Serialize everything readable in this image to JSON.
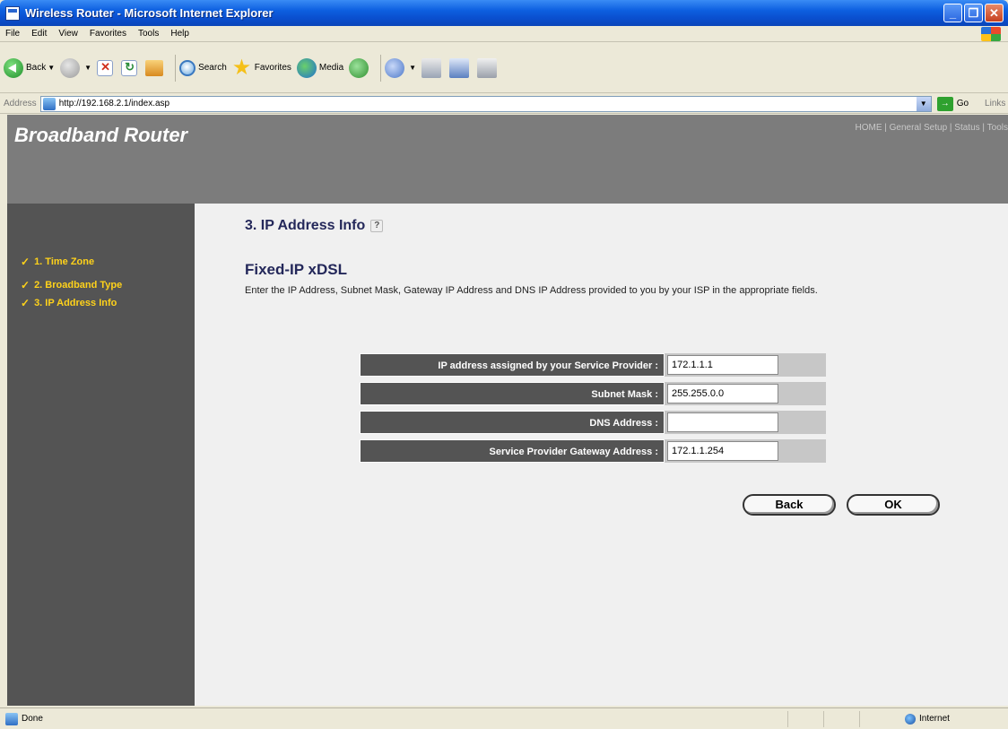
{
  "window": {
    "title": "Wireless Router - Microsoft Internet Explorer",
    "minimize": "_",
    "maximize": "❐",
    "close": "✕"
  },
  "menu": [
    "File",
    "Edit",
    "View",
    "Favorites",
    "Tools",
    "Help"
  ],
  "toolbar": {
    "back_label": "Back",
    "search_label": "Search",
    "favorites_label": "Favorites",
    "media_label": "Media"
  },
  "addressbar": {
    "label": "Address",
    "url": "http://192.168.2.1/index.asp",
    "go_label": "Go",
    "links_label": "Links"
  },
  "header": {
    "brand": "Broadband Router",
    "nav": [
      "HOME",
      "General Setup",
      "Status",
      "Tools"
    ],
    "nav_sep": " | "
  },
  "sidebar": {
    "items": [
      {
        "label": "1. Time Zone"
      },
      {
        "label": "2. Broadband Type"
      },
      {
        "label": "3. IP Address Info"
      }
    ],
    "check": "✓"
  },
  "main": {
    "section_title": "3. IP Address Info",
    "help_icon": "?",
    "sub_title": "Fixed-IP xDSL",
    "description": "Enter the IP Address, Subnet Mask, Gateway IP Address and DNS IP Address provided to you by your ISP in the appropriate fields.",
    "fields": [
      {
        "label": "IP address assigned by your Service Provider :",
        "value": "172.1.1.1"
      },
      {
        "label": "Subnet Mask :",
        "value": "255.255.0.0"
      },
      {
        "label": "DNS Address :",
        "value": ""
      },
      {
        "label": "Service Provider Gateway Address :",
        "value": "172.1.1.254"
      }
    ],
    "back_button": "Back",
    "ok_button": "OK"
  },
  "statusbar": {
    "status": "Done",
    "zone": "Internet"
  }
}
